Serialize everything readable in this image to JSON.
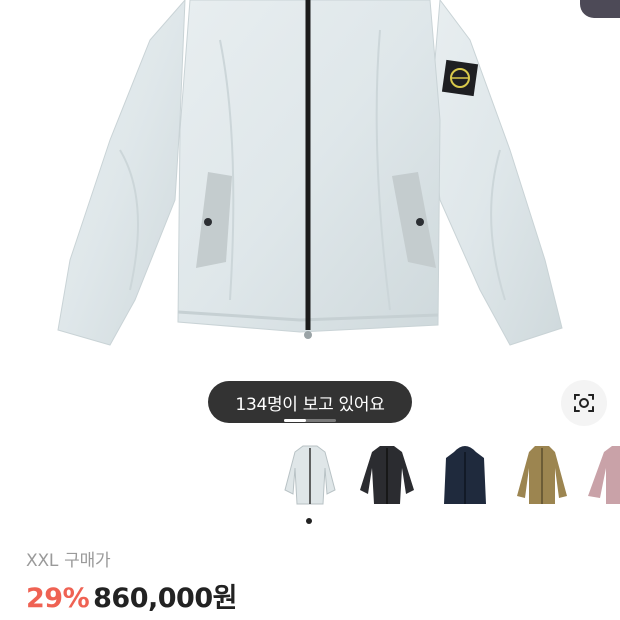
{
  "product": {
    "viewers_badge": "134명이 보고 있어요",
    "size": "XXL",
    "size_price_label": "구매가",
    "discount": "29%",
    "price": "860,000원"
  },
  "icons": {
    "lens": "image-search-icon"
  },
  "colors": {
    "jacket": [
      "#dfe6e8",
      "#2b2c30",
      "#1f2a3d",
      "#9c8550",
      "#c9a2a8"
    ],
    "discount": "#ef6253"
  },
  "thumbnails": [
    {
      "name": "thumbnail-light-grey"
    },
    {
      "name": "thumbnail-black"
    },
    {
      "name": "thumbnail-navy"
    },
    {
      "name": "thumbnail-khaki"
    },
    {
      "name": "thumbnail-pink"
    }
  ]
}
